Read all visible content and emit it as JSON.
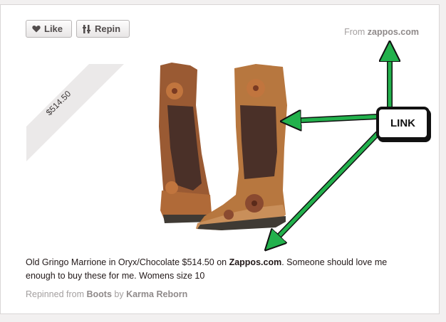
{
  "actions": {
    "like_label": "Like",
    "repin_label": "Repin"
  },
  "source": {
    "prefix": "From",
    "domain": "zappos.com"
  },
  "price": "$514.50",
  "description": {
    "text_before": "Old Gringo Marrione in Oryx/Chocolate $514.50 on ",
    "link_text": "Zappos.com",
    "text_after": ". Someone should love me enough to buy these for me. Womens size 10"
  },
  "attribution": {
    "prefix": "Repinned from",
    "board": "Boots",
    "by_word": "by",
    "user": "Karma Reborn"
  },
  "annotation": {
    "label": "LINK",
    "arrow_color": "#22b14c"
  },
  "colors": {
    "card_bg": "#ffffff",
    "page_bg": "#f2f0f0",
    "muted_text": "#a39f9f",
    "body_text": "#221919",
    "ribbon": "#ebe9e9"
  },
  "icons": [
    "heart-icon",
    "repin-icon"
  ]
}
